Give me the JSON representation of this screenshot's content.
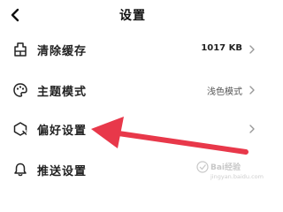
{
  "header": {
    "title": "设置",
    "back_icon": "chevron-left-icon"
  },
  "settings": [
    {
      "label": "清除缓存",
      "value": "1017 KB",
      "icon": "broom-icon",
      "chevron": true
    },
    {
      "label": "主题模式",
      "value": "浅色模式",
      "icon": "palette-icon",
      "chevron": true
    },
    {
      "label": "偏好设置",
      "value": "",
      "icon": "preference-icon",
      "chevron": true
    },
    {
      "label": "推送设置",
      "value": "",
      "icon": "bell-icon",
      "chevron": false
    }
  ],
  "annotation": {
    "arrow_color": "#e8384a"
  },
  "watermark": {
    "logo": "jingyan-logo",
    "text": "jingyan.baidu.com"
  }
}
